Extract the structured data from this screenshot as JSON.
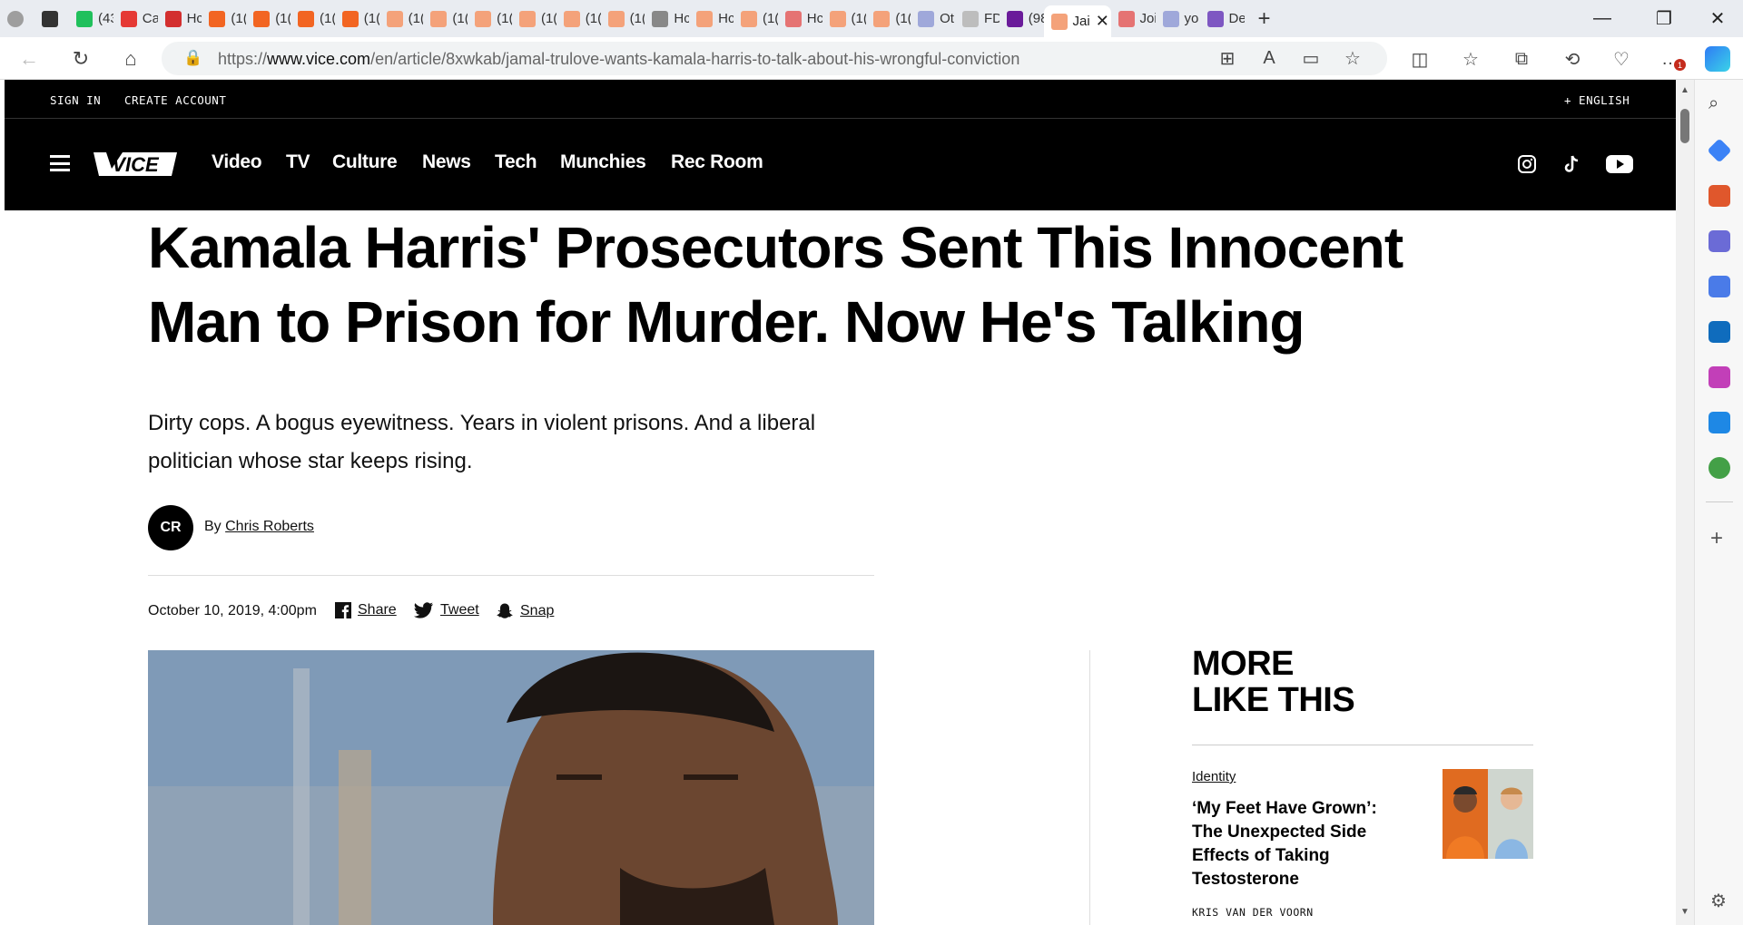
{
  "browser": {
    "tabs": [
      {
        "label": "",
        "favicon_color": "#9e9e9e"
      },
      {
        "label": "",
        "favicon_color": "#333333"
      },
      {
        "label": "(43",
        "favicon_color": "#20c05c"
      },
      {
        "label": "Ca",
        "favicon_color": "#e53935"
      },
      {
        "label": "Hc",
        "favicon_color": "#d32f2f"
      },
      {
        "label": "(1(",
        "favicon_color": "#f26522"
      },
      {
        "label": "(1(",
        "favicon_color": "#f26522"
      },
      {
        "label": "(1(",
        "favicon_color": "#f26522"
      },
      {
        "label": "(1(",
        "favicon_color": "#f26522"
      },
      {
        "label": "(1(",
        "favicon_color": "#f4a27a"
      },
      {
        "label": "(1(",
        "favicon_color": "#f4a27a"
      },
      {
        "label": "(1(",
        "favicon_color": "#f4a27a"
      },
      {
        "label": "(1(",
        "favicon_color": "#f4a27a"
      },
      {
        "label": "(1(",
        "favicon_color": "#f4a27a"
      },
      {
        "label": "(1(",
        "favicon_color": "#f4a27a"
      },
      {
        "label": "Hc",
        "favicon_color": "#888888"
      },
      {
        "label": "Hc",
        "favicon_color": "#f4a27a"
      },
      {
        "label": "(1(",
        "favicon_color": "#f4a27a"
      },
      {
        "label": "Hc",
        "favicon_color": "#e57373"
      },
      {
        "label": "(1(",
        "favicon_color": "#f4a27a"
      },
      {
        "label": "(1(",
        "favicon_color": "#f4a27a"
      },
      {
        "label": "Ot",
        "favicon_color": "#9fa8da"
      },
      {
        "label": "FD",
        "favicon_color": "#bdbdbd"
      },
      {
        "label": "(98",
        "favicon_color": "#6a1b9a"
      }
    ],
    "active_tab": {
      "label": "Jai",
      "favicon_color": "#f4a27a"
    },
    "trailing_tabs": [
      {
        "label": "Joi",
        "favicon_color": "#e57373"
      },
      {
        "label": "yo",
        "favicon_color": "#9fa8da"
      },
      {
        "label": "De",
        "favicon_color": "#7e57c2"
      }
    ],
    "url_prefix": "https://",
    "url_host": "www.vice.com",
    "url_path": "/en/article/8xwkab/jamal-trulove-wants-kamala-harris-to-talk-about-his-wrongful-conviction",
    "notification_badge": "1"
  },
  "site": {
    "sign_in": "SIGN IN",
    "create_account": "CREATE ACCOUNT",
    "language": "+ ENGLISH",
    "nav": [
      "Video",
      "TV",
      "Culture",
      "News",
      "Tech",
      "Munchies",
      "Rec Room"
    ]
  },
  "article": {
    "headline_line1": "Kamala Harris' Prosecutors Sent This Innocent",
    "headline_line2": "Man to Prison for Murder. Now He's Talking",
    "dek": "Dirty cops. A bogus eyewitness. Years in violent prisons. And a liberal politician whose star keeps rising.",
    "author_initials": "CR",
    "by": "By",
    "author": "Chris Roberts",
    "date": "October 10, 2019, 4:00pm",
    "share_facebook": "Share",
    "share_twitter": "Tweet",
    "share_snap": "Snap"
  },
  "sidebar": {
    "more_line1": "MORE",
    "more_line2": "LIKE THIS",
    "card": {
      "category": "Identity",
      "title": "‘My Feet Have Grown’: The Unexpected Side Effects of Taking Testosterone",
      "author": "KRIS VAN DER VOORN"
    }
  }
}
